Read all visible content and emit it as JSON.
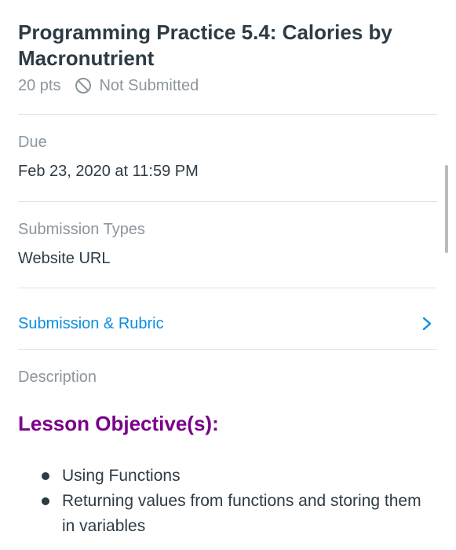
{
  "assignment": {
    "title": "Programming Practice 5.4: Calories by Macronutrient",
    "points": "20 pts",
    "status": "Not Submitted"
  },
  "details": {
    "due_label": "Due",
    "due_value": "Feb 23, 2020 at 11:59 PM",
    "submission_types_label": "Submission Types",
    "submission_types_value": "Website URL",
    "rubric_link": "Submission & Rubric",
    "description_label": "Description"
  },
  "description": {
    "heading": "Lesson Objective(s):",
    "objectives": [
      "Using Functions",
      "Returning values from functions and storing them in variables"
    ]
  },
  "colors": {
    "text": "#2d3b45",
    "muted": "#8b969e",
    "link": "#0b8ee0",
    "heading_accent": "#7a0089",
    "divider": "#dfe3e6"
  },
  "icons": {
    "status": "ban-icon",
    "rubric": "chevron-right-icon"
  }
}
